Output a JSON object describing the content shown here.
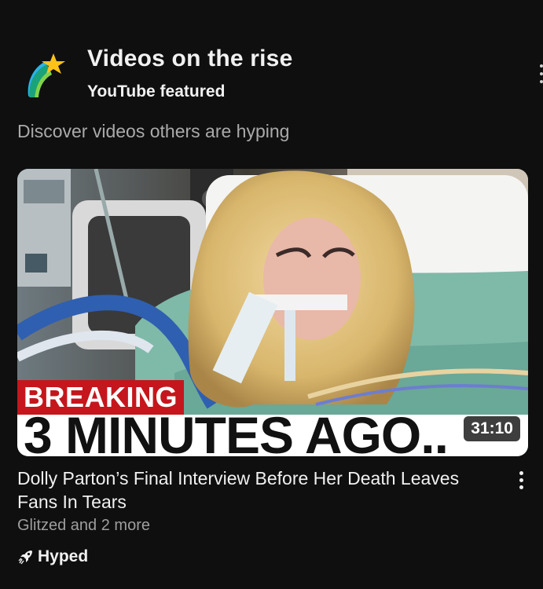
{
  "shelf": {
    "title": "Videos on the rise",
    "subtitle": "YouTube featured",
    "description": "Discover videos others are hyping",
    "logo_icon": "shooting-star-icon"
  },
  "video": {
    "thumbnail_tag": "BREAKING",
    "thumbnail_headline": "3 MINUTES AGO..",
    "duration": "31:10",
    "title": "Dolly Parton’s Final Interview Before Her Death Leaves Fans In Tears",
    "channel": "Glitzed and 2 more",
    "badge_label": "Hyped",
    "badge_icon": "hype-rocket-icon",
    "menu_icon": "more-vert-icon"
  },
  "colors": {
    "background": "#0f0f0f",
    "breaking_red": "#c4161c",
    "secondary_text": "#aaaaaa"
  }
}
